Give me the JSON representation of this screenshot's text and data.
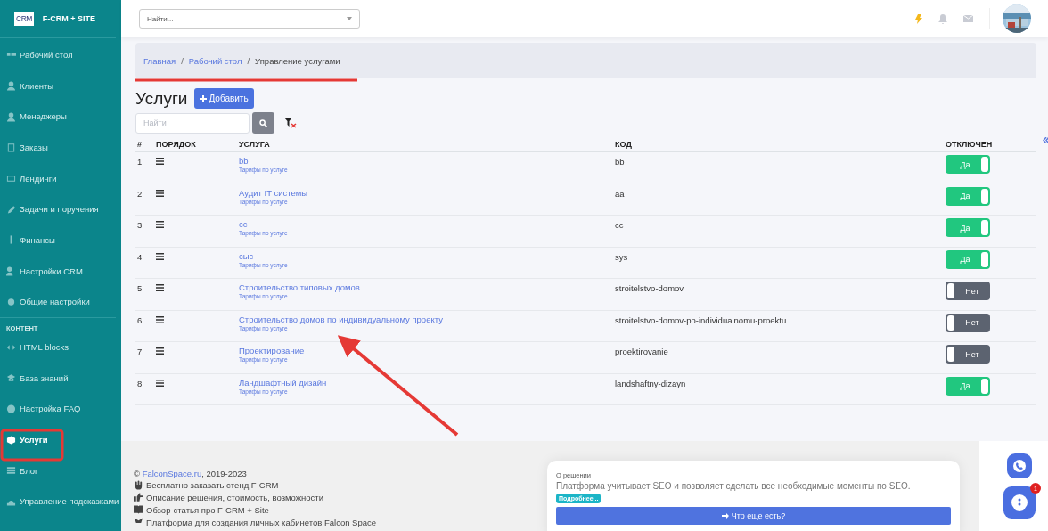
{
  "brand": {
    "logo": "CRM",
    "name": "F-CRM + SITE"
  },
  "sidebar": {
    "items": [
      {
        "label": "Рабочий стол",
        "selected": false
      },
      {
        "label": "Клиенты",
        "selected": false
      },
      {
        "label": "Менеджеры",
        "selected": false
      },
      {
        "label": "Заказы",
        "selected": false
      },
      {
        "label": "Лендинги",
        "selected": false
      },
      {
        "label": "Задачи и поручения",
        "selected": false
      },
      {
        "label": "Финансы",
        "selected": false
      },
      {
        "label": "Настройки CRM",
        "selected": false
      },
      {
        "label": "Общие настройки",
        "selected": false
      }
    ],
    "section_title": "КОНТЕНТ",
    "content_items": [
      {
        "label": "HTML blocks",
        "selected": false
      },
      {
        "label": "База знаний",
        "selected": false
      },
      {
        "label": "Настройка FAQ",
        "selected": false
      },
      {
        "label": "Услуги",
        "selected": true
      },
      {
        "label": "Блог",
        "selected": false
      },
      {
        "label": "Управление подсказками",
        "selected": false
      }
    ]
  },
  "header": {
    "search": {
      "placeholder": "Найти..."
    }
  },
  "breadcrumb": [
    {
      "label": "Главная",
      "kind": "link"
    },
    {
      "label": "/",
      "kind": "separator"
    },
    {
      "label": "Рабочий стол",
      "kind": "link"
    },
    {
      "label": "/",
      "kind": "separator"
    },
    {
      "label": "Управление услугами",
      "kind": "current"
    }
  ],
  "page_title": "Услуги",
  "add_button": "Добавить",
  "filter": {
    "placeholder": "Найти"
  },
  "table": {
    "columns": [
      "#",
      "ПОРЯДОК",
      "УСЛУГА",
      "КОД",
      "ОТКЛЮЧЕН"
    ],
    "rows": [
      {
        "num": "1",
        "service": "bb",
        "tariffs": "Тарифы по услуге",
        "code": "bb",
        "toggle": "Да",
        "on": true
      },
      {
        "num": "2",
        "service": "Аудит IT системы",
        "tariffs": "Тарифы по услуге",
        "code": "aa",
        "toggle": "Да",
        "on": true
      },
      {
        "num": "3",
        "service": "cc",
        "tariffs": "Тарифы по услуге",
        "code": "cc",
        "toggle": "Да",
        "on": true
      },
      {
        "num": "4",
        "service": "сыс",
        "tariffs": "Тарифы по услуге",
        "code": "sys",
        "toggle": "Да",
        "on": true
      },
      {
        "num": "5",
        "service": "Строительство типовых домов",
        "tariffs": "Тарифы по услуге",
        "code": "stroitelstvo-domov",
        "toggle": "Нет",
        "on": false
      },
      {
        "num": "6",
        "service": "Строительство домов по индивидуальному проекту",
        "tariffs": "Тарифы по услуге",
        "code": "stroitelstvo-domov-po-individualnomu-proektu",
        "toggle": "Нет",
        "on": false
      },
      {
        "num": "7",
        "service": "Проектирование",
        "tariffs": "Тарифы по услуге",
        "code": "proektirovanie",
        "toggle": "Нет",
        "on": false
      },
      {
        "num": "8",
        "service": "Ландшафтный дизайн",
        "tariffs": "Тарифы по услуге",
        "code": "landshaftny-dizayn",
        "toggle": "Да",
        "on": true
      }
    ]
  },
  "footer": {
    "copyright_sign": "©",
    "copyright_link": "FalconSpace.ru",
    "copyright_rest": ", 2019-2023",
    "links": [
      "Бесплатно заказать стенд F-CRM",
      "Описание решения, стоимость, возможности",
      "Обзор-статья про F-CRM + Site",
      "Платформа для создания личных кабинетов Falcon Space"
    ]
  },
  "info_card": {
    "label": "О решении",
    "text": "Платформа учитывает SEO и позволяет сделать все необходимые моменты по SEO.",
    "badge": "Подробнее...",
    "button": "Что еще есть?"
  },
  "chat": {
    "badge": "1"
  }
}
